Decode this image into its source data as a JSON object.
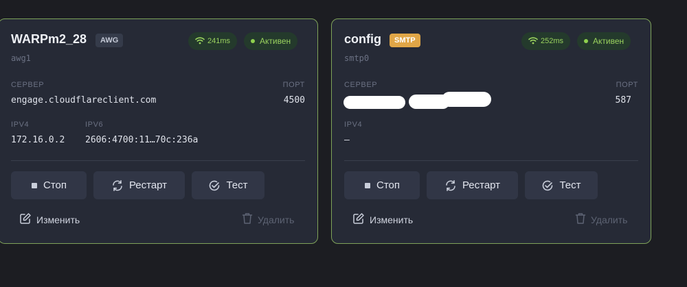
{
  "cards": [
    {
      "name": "WARPm2_28",
      "tag": "AWG",
      "interface": "awg1",
      "ping": "241ms",
      "status": "Активен",
      "server_label": "СЕРВЕР",
      "server": "engage.cloudflareclient.com",
      "port_label": "ПОРТ",
      "port": "4500",
      "ipv4_label": "IPV4",
      "ipv4": "172.16.0.2",
      "ipv6_label": "IPV6",
      "ipv6": "2606:4700:11…70c:236a",
      "buttons": {
        "stop": "Стоп",
        "restart": "Рестарт",
        "test": "Тест"
      },
      "edit": "Изменить",
      "delete": "Удалить"
    },
    {
      "name": "config",
      "tag": "SMTP",
      "interface": "smtp0",
      "ping": "252ms",
      "status": "Активен",
      "server_label": "СЕРВЕР",
      "server": "",
      "port_label": "ПОРТ",
      "port": "587",
      "ipv4_label": "IPV4",
      "ipv4": "—",
      "buttons": {
        "stop": "Стоп",
        "restart": "Рестарт",
        "test": "Тест"
      },
      "edit": "Изменить",
      "delete": "Удалить"
    }
  ],
  "colors": {
    "background": "#1c1d22",
    "card": "#262a36",
    "card_border": "#7fa35a",
    "status_green": "#9ad25e",
    "smtp_tag": "#e0a647"
  },
  "icons": [
    "wifi-icon",
    "status-dot-icon",
    "stop-icon",
    "restart-icon",
    "test-check-icon",
    "edit-icon",
    "trash-icon"
  ]
}
